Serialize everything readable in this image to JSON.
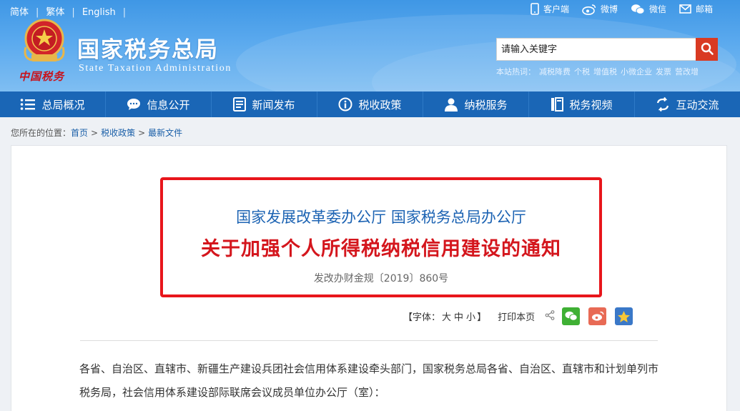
{
  "header": {
    "lang_links": [
      "简体",
      "繁体",
      "English"
    ],
    "top_links": [
      {
        "icon": "mobile-icon",
        "label": "客户端"
      },
      {
        "icon": "weibo-icon",
        "label": "微博"
      },
      {
        "icon": "wechat-icon",
        "label": "微信"
      },
      {
        "icon": "mail-icon",
        "label": "邮箱"
      }
    ],
    "emblem_caption": "中国税务",
    "site_title_cn": "国家税务总局",
    "site_title_en": "State Taxation Administration",
    "search": {
      "placeholder": "请输入关键字"
    },
    "hot_label": "本站热词：",
    "hot_words": [
      "减税降费",
      "个税",
      "增值税",
      "小微企业",
      "发票",
      "营改增"
    ],
    "colors": {
      "header_blue": "#3f97e5",
      "nav_blue": "#1a66b6",
      "search_red": "#d93a22"
    }
  },
  "nav": {
    "items": [
      {
        "icon": "menu-icon",
        "label": "总局概况"
      },
      {
        "icon": "chat-icon",
        "label": "信息公开"
      },
      {
        "icon": "document-icon",
        "label": "新闻发布"
      },
      {
        "icon": "info-icon",
        "label": "税收政策"
      },
      {
        "icon": "person-icon",
        "label": "纳税服务"
      },
      {
        "icon": "video-icon",
        "label": "税务视频"
      },
      {
        "icon": "exchange-icon",
        "label": "互动交流"
      }
    ]
  },
  "breadcrumb": {
    "prefix": "您所在的位置：",
    "items": [
      "首页",
      "税收政策",
      "最新文件"
    ]
  },
  "article": {
    "issuer": "国家发展改革委办公厅 国家税务总局办公厅",
    "title": "关于加强个人所得税纳税信用建设的通知",
    "doc_number": "发改办财金规〔2019〕860号",
    "tools": {
      "font_prefix": "【字体：",
      "font_large": "大",
      "font_medium": "中",
      "font_small": "小",
      "font_suffix": "】",
      "print": "打印本页"
    },
    "body_paragraph": "各省、自治区、直辖市、新疆生产建设兵团社会信用体系建设牵头部门，国家税务总局各省、自治区、直辖市和计划单列市税务局，社会信用体系建设部际联席会议成员单位办公厅（室）：",
    "highlight_color": "#e8151b"
  }
}
